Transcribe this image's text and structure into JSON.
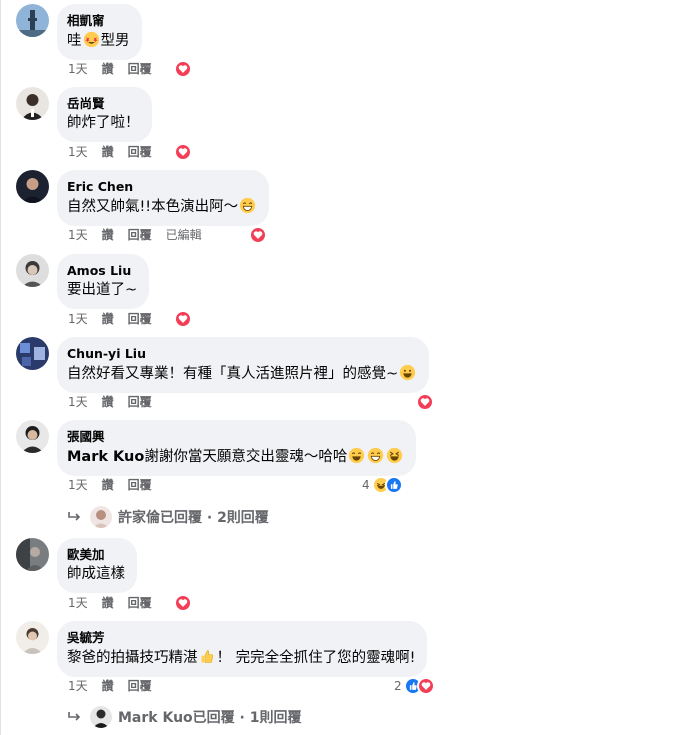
{
  "comments": [
    {
      "author": "相凱甯",
      "text": "哇",
      "text2": "型男",
      "time": "1天",
      "like": "讚",
      "reply": "回覆",
      "reaction": "heart"
    },
    {
      "author": "岳尚賢",
      "text": "帥炸了啦！",
      "time": "1天",
      "like": "讚",
      "reply": "回覆",
      "reaction": "heart"
    },
    {
      "author": "Eric Chen",
      "text": "自然又帥氣!!本色演出阿～",
      "time": "1天",
      "like": "讚",
      "reply": "回覆",
      "edited": "已編輯",
      "reaction": "heart"
    },
    {
      "author": "Amos Liu",
      "text": "要出道了~",
      "time": "1天",
      "like": "讚",
      "reply": "回覆",
      "reaction": "heart"
    },
    {
      "author": "Chun-yi Liu",
      "text": "自然好看又專業！有種「真人活進照片裡」的感覺~",
      "time": "1天",
      "like": "讚",
      "reply": "回覆",
      "reaction": "heart"
    },
    {
      "author": "張國興",
      "mention": "Mark Kuo",
      "text": "謝謝你當天願意交出靈魂～哈哈",
      "time": "1天",
      "like": "讚",
      "reply": "回覆",
      "reaction_count": "4",
      "reaction": "haha-like",
      "replies": "許家倫已回覆 · 2則回覆"
    },
    {
      "author": "歐美加",
      "text": "帥成這樣",
      "time": "1天",
      "like": "讚",
      "reply": "回覆",
      "reaction": "heart"
    },
    {
      "author": "吳毓芳",
      "text": "黎爸的拍攝技巧精湛",
      "text2": "！ 完完全全抓住了您的靈魂啊!",
      "time": "1天",
      "like": "讚",
      "reply": "回覆",
      "reaction_count": "2",
      "reaction": "like-heart",
      "replies": "Mark Kuo已回覆 · 1則回覆"
    }
  ],
  "colors": {
    "bubble": "#f0f2f5",
    "meta": "#65676b",
    "heart": "#f33e58",
    "like": "#1877f2"
  }
}
